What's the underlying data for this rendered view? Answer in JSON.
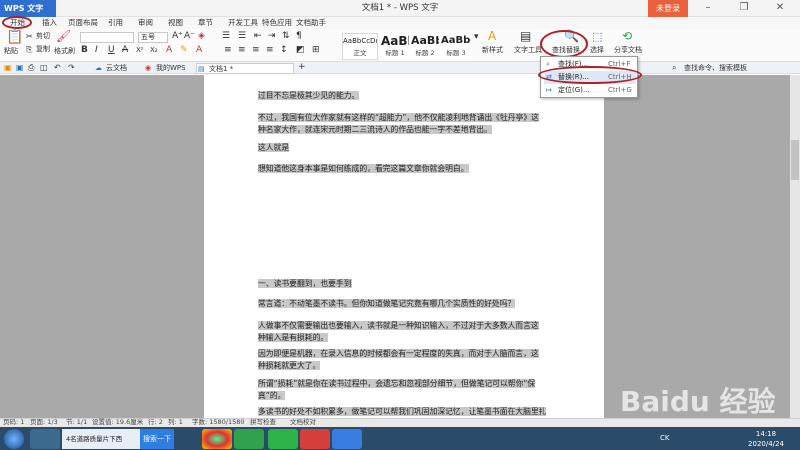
{
  "titlebar": {
    "app": "WPS 文字",
    "title": "文档1 * - WPS 文字",
    "login": "未登录"
  },
  "menu": [
    "开始",
    "插入",
    "页面布局",
    "引用",
    "审阅",
    "视图",
    "章节",
    "开发工具",
    "特色应用",
    "文档助手"
  ],
  "ribbon": {
    "paste": "粘贴",
    "cut": "剪切",
    "copy": "复制",
    "format_painter": "格式刷",
    "font_size": "五号",
    "styles": [
      {
        "preview": "AaBbCcDd",
        "label": "正文"
      },
      {
        "preview": "AaBl",
        "label": "标题 1"
      },
      {
        "preview": "AaBb",
        "label": "标题 2"
      },
      {
        "preview": "AaBbC",
        "label": "标题 3"
      }
    ],
    "new_style": "新样式",
    "text_tools": "文字工具",
    "find_replace": "查找替换",
    "select": "选择",
    "share": "分享文档"
  },
  "dropdown": [
    {
      "label": "查找(F)...",
      "shortcut": "Ctrl+F"
    },
    {
      "label": "替换(R)...",
      "shortcut": "Ctrl+H"
    },
    {
      "label": "定位(G)...",
      "shortcut": "Ctrl+G"
    }
  ],
  "tabs": [
    "云文档",
    "我的WPS",
    "文档1 *"
  ],
  "search_hint": "查找命令、搜索模板",
  "paragraphs": [
    "过目不忘是极其少见的能力。",
    "不过，我国有位大作家就有这样的“超能力”，他不仅能凌利地背诵出《牡丹亭》这种名家大作，就连宋元时期二三流诗人的作品也能一字不差地背出。",
    "这人就是",
    "想知道他这身本事是如何练成的，看完这篇文章你就会明白。",
    "一、读书要翻到，也要手到",
    "常言道：不动笔墨不读书。但你知道做笔记究竟有哪几个实质性的好处吗？",
    "人做事不仅需要输出也要输入，读书就是一种知识输入，不过对于大多数人而言这种输入是有损耗的。",
    "因为即便是机器，在录入信息的时候都会有一定程度的失真，而对于人脑而言，这种损耗就更大了。",
    "所谓“损耗”就是你在读书过程中，会遗忘和忽视部分细节，但做笔记可以帮你“保真”的。",
    "多读书的好处不如积累多，做笔记可以帮我们巩固加深记忆，让笔墨书面在大脑里扎根"
  ],
  "status": {
    "page": "页码: 1",
    "pages": "页面: 1/3",
    "section": "节: 1/1",
    "setting": "设置值: 19.6厘米",
    "row": "行: 2",
    "col": "列: 1",
    "words": "字数: 1580/1580",
    "spell": "拼写检查",
    "proof": "文档校对"
  },
  "taskbar": {
    "search_tab": "4名道路质量片下西",
    "search_btn": "搜索一下",
    "lang": "CK",
    "time": "14:18",
    "date": "2020/4/24"
  },
  "watermark": "Baidu 经验"
}
